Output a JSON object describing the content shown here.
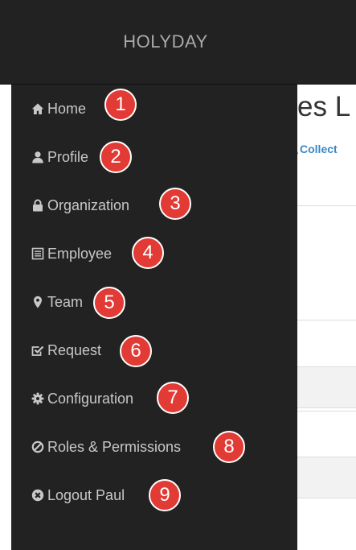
{
  "brand": "HOLYDAY",
  "page": {
    "heading_fragment": "es L",
    "collect_link": "Collect"
  },
  "nav": [
    {
      "label": "Home",
      "icon": "home-icon",
      "badge": "1"
    },
    {
      "label": "Profile",
      "icon": "user-icon",
      "badge": "2"
    },
    {
      "label": "Organization",
      "icon": "lock-icon",
      "badge": "3"
    },
    {
      "label": "Employee",
      "icon": "list-alt-icon",
      "badge": "4"
    },
    {
      "label": "Team",
      "icon": "map-marker-icon",
      "badge": "5"
    },
    {
      "label": "Request",
      "icon": "check-square-icon",
      "badge": "6"
    },
    {
      "label": "Configuration",
      "icon": "cog-icon",
      "badge": "7"
    },
    {
      "label": "Roles & Permissions",
      "icon": "ban-circle-icon",
      "badge": "8"
    },
    {
      "label": "Logout Paul",
      "icon": "remove-sign-icon",
      "badge": "9"
    }
  ],
  "colors": {
    "topbar": "#222222",
    "sidebar": "#222222",
    "nav_text": "#c8c8c8",
    "badge": "#e23a34",
    "link": "#3a87c8"
  }
}
